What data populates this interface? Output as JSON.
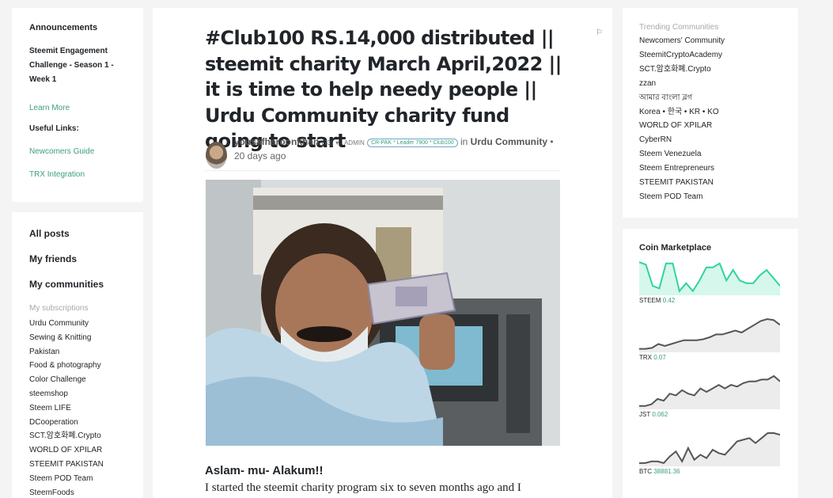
{
  "left": {
    "announcements": {
      "heading": "Announcements",
      "item_text": "Steemit Engagement Challenge - Season 1 - Week 1",
      "learn_more": "Learn More",
      "useful_heading": "Useful Links:",
      "links": [
        "Newcomers Guide",
        "TRX Integration"
      ]
    },
    "nav": {
      "all_posts": "All posts",
      "my_friends": "My friends",
      "my_communities": "My communities",
      "subscriptions_heading": "My subscriptions",
      "subscriptions": [
        "Urdu Community",
        "Sewing & Knitting",
        "Pakistan",
        "Food & photography",
        "Color Challenge",
        "steemshop",
        "Steem LIFE",
        "DCooperation",
        "SCT.암호화폐.Crypto",
        "WORLD OF XPILAR",
        "STEEMIT PAKISTAN",
        "Steem POD Team",
        "SteemFoods"
      ]
    }
  },
  "post": {
    "title": "#Club100 RS.14,000 distributed || steemit charity March April,2022 || it is time to help needy people || Urdu Community charity fund going to start",
    "flag": "⚐",
    "author": "yousafharoonkhan",
    "reputation": "(73)",
    "caret": "▾",
    "role": "ADMIN",
    "badge": "CR-PAK * Leader 7900 * Club100",
    "in_word": "in",
    "community": "Urdu Community",
    "time": "• 20 days ago",
    "greeting": "Aslam- mu- Alakum!!",
    "body_first_line": "I started the steemit charity program six to seven months ago and I"
  },
  "right": {
    "trending": {
      "heading": "Trending Communities",
      "items": [
        "Newcomers' Community",
        "SteemitCryptoAcademy",
        "SCT.암호화폐.Crypto",
        "zzan",
        "আমার বাংলা ব্লগ",
        "Korea • 한국 • KR • KO",
        "WORLD OF XPILAR",
        "CyberRN",
        "Steem Venezuela",
        "Steem Entrepreneurs",
        "STEEMIT PAKISTAN",
        "Steem POD Team"
      ]
    },
    "market": {
      "heading": "Coin Marketplace",
      "coins": [
        {
          "symbol": "STEEM",
          "price": "0.42",
          "color": "#2fd3a0",
          "fill": "#d6f7ec",
          "series": [
            28,
            26,
            10,
            8,
            27,
            27,
            6,
            12,
            6,
            14,
            24,
            24,
            27,
            14,
            22,
            14,
            12,
            12,
            18,
            22,
            16,
            10
          ]
        },
        {
          "symbol": "TRX",
          "price": "0.07",
          "color": "#555555",
          "fill": "#ececec",
          "series": [
            5,
            5,
            6,
            10,
            8,
            10,
            12,
            14,
            14,
            14,
            15,
            17,
            20,
            20,
            22,
            24,
            22,
            26,
            30,
            34,
            36,
            35,
            30
          ]
        },
        {
          "symbol": "JST",
          "price": "0.062",
          "color": "#555555",
          "fill": "#ececec",
          "series": [
            6,
            6,
            8,
            14,
            12,
            20,
            18,
            24,
            20,
            18,
            26,
            22,
            26,
            30,
            26,
            30,
            28,
            32,
            34,
            34,
            36,
            36,
            40,
            34
          ]
        },
        {
          "symbol": "BTC",
          "price": "38881.36",
          "color": "#555555",
          "fill": "#ececec",
          "series": [
            4,
            4,
            6,
            6,
            4,
            12,
            18,
            6,
            22,
            8,
            14,
            10,
            20,
            16,
            14,
            22,
            30,
            32,
            34,
            28,
            34,
            40,
            40,
            38
          ]
        }
      ]
    }
  }
}
